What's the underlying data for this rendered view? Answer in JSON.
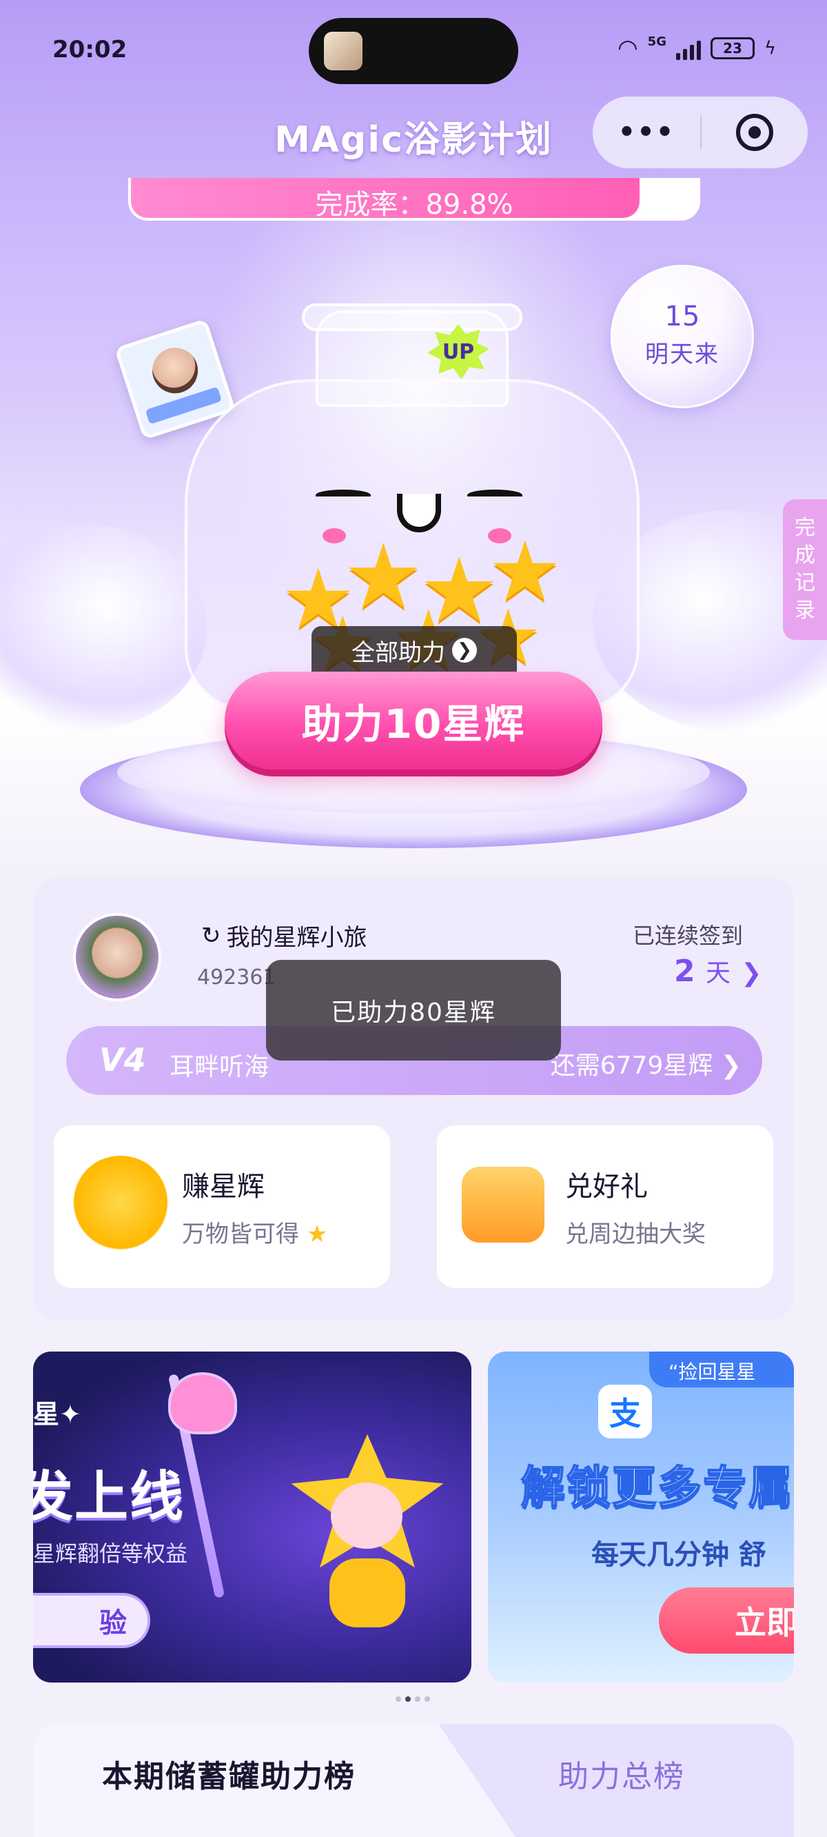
{
  "status": {
    "time": "20:02",
    "network": "5G",
    "battery": "23"
  },
  "nav": {
    "title": "MAgic浴影计划",
    "more_label": "•••"
  },
  "progress": {
    "label": "完成率：89.8%",
    "fraction": 0.898
  },
  "bubble": {
    "number": "15",
    "text": "明天来"
  },
  "side_tab": {
    "label": "完成记录"
  },
  "jar": {
    "up_badge": "UP",
    "all_assist_label": "全部助力",
    "all_assist_arrow": "❯"
  },
  "assist_button": {
    "label": "助力10星辉"
  },
  "user": {
    "name": "我的星辉小旅",
    "name_prefix_icon": "↻",
    "id": "492361",
    "checkin_label": "已连续签到",
    "checkin_days": "2",
    "checkin_unit": "天",
    "checkin_arrow": "❯"
  },
  "vip": {
    "level": "V4",
    "name": "耳畔听海",
    "expire_text": "还需6779星辉",
    "arrow": "❯"
  },
  "toast": {
    "text": "已助力80星辉"
  },
  "cards": [
    {
      "title": "赚星辉",
      "subtitle": "万物皆可得",
      "icon": "smiling-star-icon",
      "sub_icon": "★"
    },
    {
      "title": "兑好礼",
      "subtitle": "兑周边抽大奖",
      "icon": "gift-box-icon"
    }
  ],
  "banner1": {
    "tag": "星✦",
    "headline": "发上线",
    "subtitle": "星辉翻倍等权益",
    "cta": "验"
  },
  "banner2": {
    "corner_tag": "“捡回星星",
    "logo": "支",
    "headline": "解锁更多专属",
    "subtitle": "每天几分钟 舒",
    "cta": "立即"
  },
  "carousel": {
    "count": 4,
    "active_index": 1
  },
  "board_tabs": {
    "current": "本期储蓄罐助力榜",
    "total": "助力总榜"
  },
  "colors": {
    "accent_purple": "#7e4ff0",
    "button_pink": "#ff4fae",
    "progress_pink": "#ff5fb5",
    "side_tab": "#e9a4ef"
  }
}
